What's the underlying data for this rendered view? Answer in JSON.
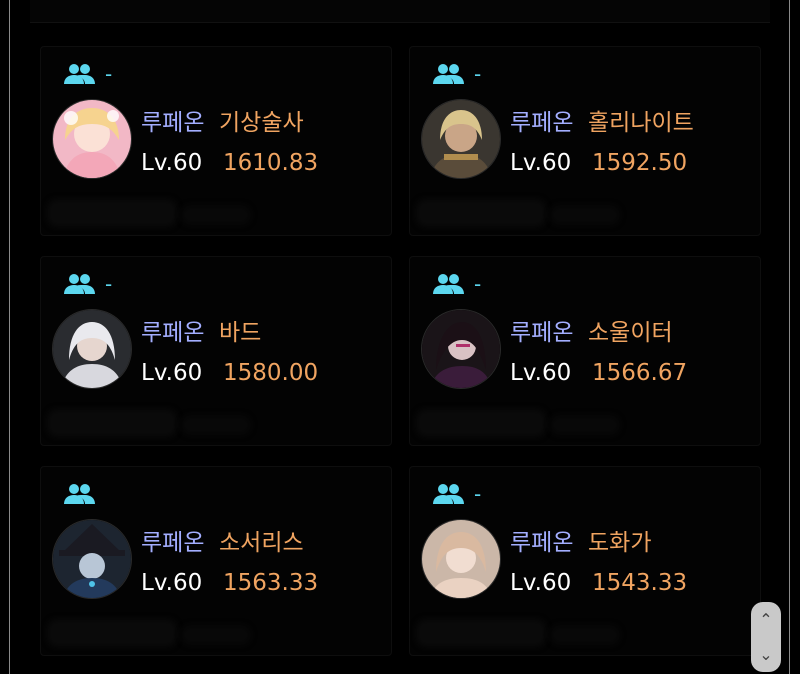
{
  "cards": [
    {
      "party": "-",
      "server": "루페온",
      "class": "기상술사",
      "level": "Lv.60",
      "item_level": "1610.83",
      "avatar": "aeromancer-portrait"
    },
    {
      "party": "-",
      "server": "루페온",
      "class": "홀리나이트",
      "level": "Lv.60",
      "item_level": "1592.50",
      "avatar": "paladin-portrait"
    },
    {
      "party": "-",
      "server": "루페온",
      "class": "바드",
      "level": "Lv.60",
      "item_level": "1580.00",
      "avatar": "bard-portrait"
    },
    {
      "party": "-",
      "server": "루페온",
      "class": "소울이터",
      "level": "Lv.60",
      "item_level": "1566.67",
      "avatar": "souleater-portrait"
    },
    {
      "party": "",
      "server": "루페온",
      "class": "소서리스",
      "level": "Lv.60",
      "item_level": "1563.33",
      "avatar": "sorceress-portrait"
    },
    {
      "party": "-",
      "server": "루페온",
      "class": "도화가",
      "level": "Lv.60",
      "item_level": "1543.33",
      "avatar": "artist-portrait"
    }
  ],
  "icons": {
    "party": "party-icon",
    "scroll_up": "chevron-up-icon",
    "scroll_down": "chevron-down-icon"
  },
  "colors": {
    "server": "#a3aeff",
    "class": "#f0a461",
    "level": "#ffffff",
    "item_level": "#f0a461",
    "party_icon": "#5cd7ef",
    "background": "#000000"
  },
  "scroll": {
    "up": "⌃",
    "down": "⌄"
  }
}
